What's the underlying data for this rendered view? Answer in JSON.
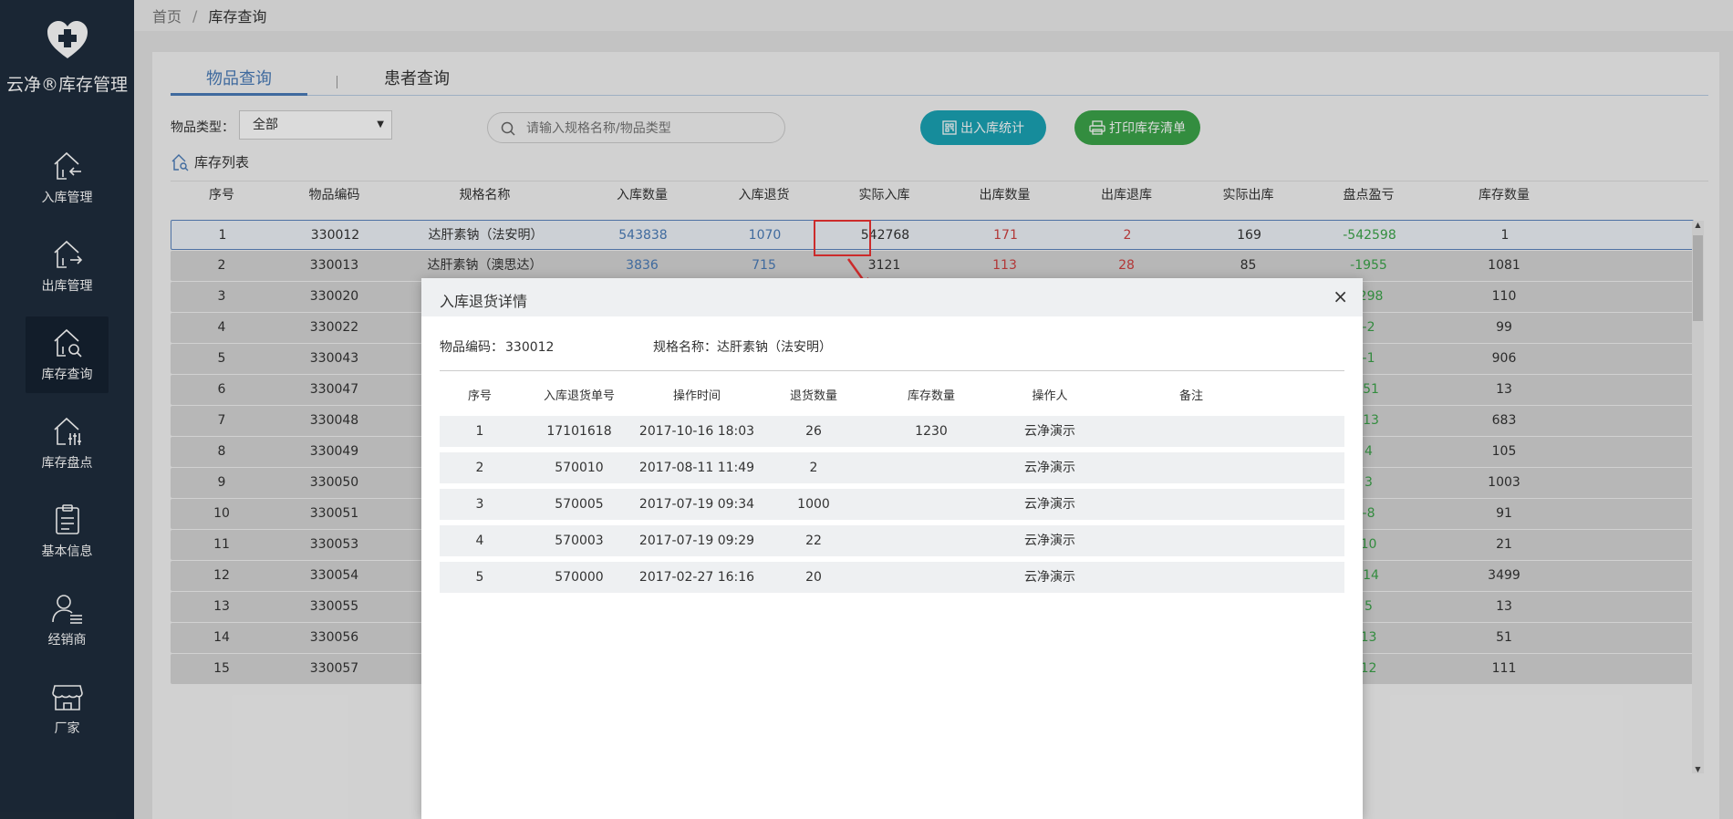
{
  "app": {
    "logo_text": "云净®库存管理"
  },
  "sidebar": {
    "items": [
      {
        "label": "入库管理",
        "icon": "inbound-icon"
      },
      {
        "label": "出库管理",
        "icon": "outbound-icon"
      },
      {
        "label": "库存查询",
        "icon": "inventory-search-icon",
        "active": true
      },
      {
        "label": "库存盘点",
        "icon": "stocktake-icon"
      },
      {
        "label": "基本信息",
        "icon": "clipboard-icon"
      },
      {
        "label": "经销商",
        "icon": "dealer-icon"
      },
      {
        "label": "厂家",
        "icon": "store-icon"
      }
    ]
  },
  "breadcrumb": {
    "home": "首页",
    "separator": "/",
    "current": "库存查询"
  },
  "tabs": [
    {
      "label": "物品查询",
      "active": true
    },
    {
      "label": "患者查询"
    }
  ],
  "filter": {
    "type_label": "物品类型：",
    "type_value": "全部",
    "search_placeholder": "请输入规格名称/物品类型",
    "btn_stats": "出入库统计",
    "btn_print": "打印库存清单"
  },
  "list_title": "库存列表",
  "table": {
    "headers": [
      "序号",
      "物品编码",
      "规格名称",
      "入库数量",
      "入库退货",
      "实际入库",
      "出库数量",
      "出库退库",
      "实际出库",
      "盘点盈亏",
      "库存数量"
    ],
    "rows": [
      {
        "no": "1",
        "code": "330012",
        "name": "达肝素钠（法安明）",
        "in_qty": "543838",
        "in_return": "1070",
        "actual_in": "542768",
        "out_qty": "171",
        "out_return": "2",
        "actual_out": "169",
        "diff": "-542598",
        "stock": "1"
      },
      {
        "no": "2",
        "code": "330013",
        "name": "达肝素钠（澳思达）",
        "in_qty": "3836",
        "in_return": "715",
        "actual_in": "3121",
        "out_qty": "113",
        "out_return": "28",
        "actual_out": "85",
        "diff": "-1955",
        "stock": "1081"
      },
      {
        "no": "3",
        "code": "330020",
        "diff": "-298",
        "stock": "110"
      },
      {
        "no": "4",
        "code": "330022",
        "diff": "-2",
        "stock": "99"
      },
      {
        "no": "5",
        "code": "330043",
        "diff": "-1",
        "stock": "906"
      },
      {
        "no": "6",
        "code": "330047",
        "diff": "-51",
        "stock": "13"
      },
      {
        "no": "7",
        "code": "330048",
        "diff": "-13",
        "stock": "683"
      },
      {
        "no": "8",
        "code": "330049",
        "diff": "4",
        "stock": "105"
      },
      {
        "no": "9",
        "code": "330050",
        "diff": "3",
        "stock": "1003"
      },
      {
        "no": "10",
        "code": "330051",
        "diff": "-8",
        "stock": "91"
      },
      {
        "no": "11",
        "code": "330053",
        "diff": "10",
        "stock": "21"
      },
      {
        "no": "12",
        "code": "330054",
        "diff": "-14",
        "stock": "3499"
      },
      {
        "no": "13",
        "code": "330055",
        "diff": "5",
        "stock": "13"
      },
      {
        "no": "14",
        "code": "330056",
        "diff": "13",
        "stock": "51"
      },
      {
        "no": "15",
        "code": "330057",
        "diff": "12",
        "stock": "111"
      }
    ]
  },
  "modal": {
    "title": "入库退货详情",
    "close": "×",
    "code_label": "物品编码：",
    "code_value": "330012",
    "spec_label": "规格名称：",
    "spec_value": "达肝素钠（法安明）",
    "headers": [
      "序号",
      "入库退货单号",
      "操作时间",
      "退货数量",
      "库存数量",
      "操作人",
      "备注"
    ],
    "rows": [
      {
        "no": "1",
        "order": "17101618",
        "time": "2017-10-16 18:03",
        "qty": "26",
        "stock": "1230",
        "operator": "云净演示",
        "note": ""
      },
      {
        "no": "2",
        "order": "570010",
        "time": "2017-08-11 11:49",
        "qty": "2",
        "stock": "",
        "operator": "云净演示",
        "note": ""
      },
      {
        "no": "3",
        "order": "570005",
        "time": "2017-07-19 09:34",
        "qty": "1000",
        "stock": "",
        "operator": "云净演示",
        "note": ""
      },
      {
        "no": "4",
        "order": "570003",
        "time": "2017-07-19 09:29",
        "qty": "22",
        "stock": "",
        "operator": "云净演示",
        "note": ""
      },
      {
        "no": "5",
        "order": "570000",
        "time": "2017-02-27 16:16",
        "qty": "20",
        "stock": "",
        "operator": "云净演示",
        "note": ""
      }
    ]
  },
  "colors": {
    "sidebar_bg": "#1f2d3d",
    "accent_blue": "#4a7cb8",
    "teal": "#1aa3b5",
    "green": "#3ca54a",
    "red": "#d04040",
    "highlight": "#e33333"
  }
}
